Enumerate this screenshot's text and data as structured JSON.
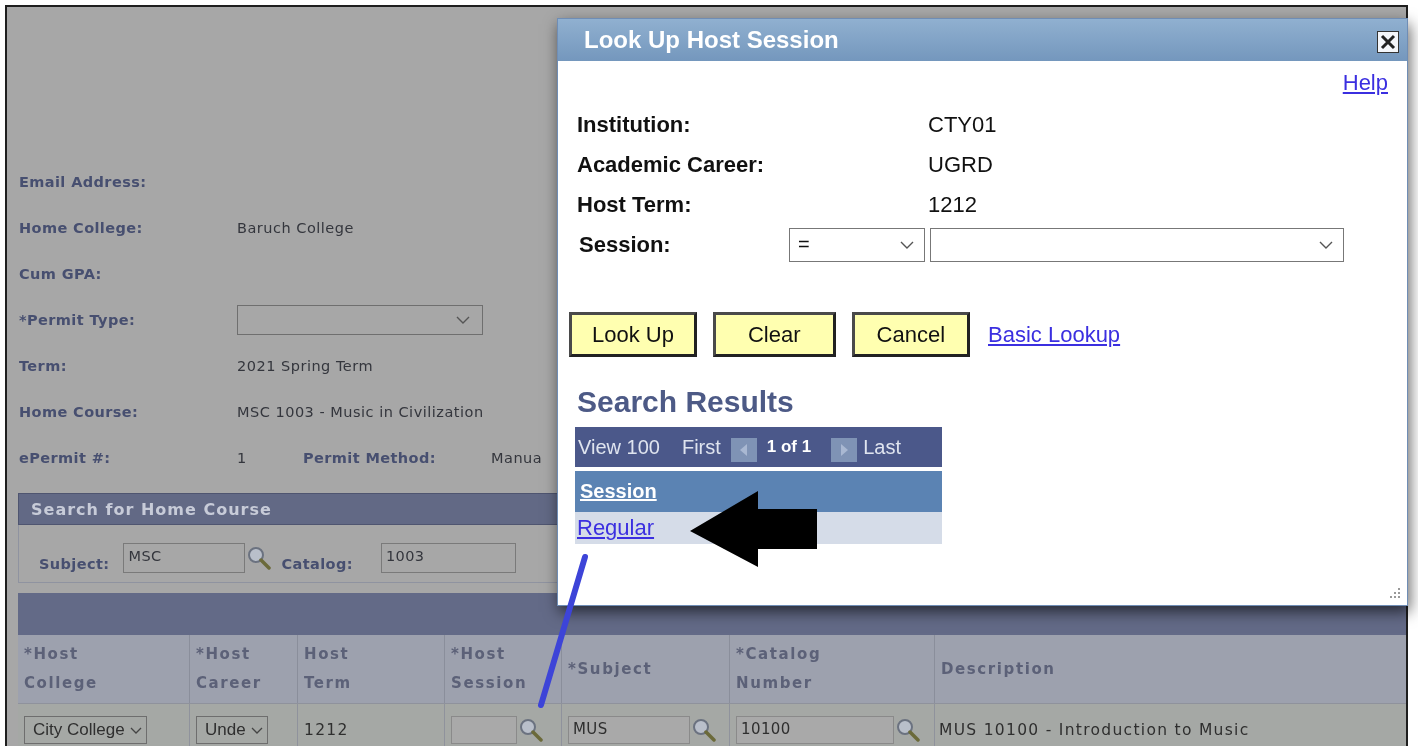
{
  "page": {
    "fields": [
      {
        "kind": "text",
        "label": "Email Address:"
      },
      {
        "kind": "text",
        "label": "Home College:",
        "value": "Baruch College"
      },
      {
        "kind": "text",
        "label": "Cum GPA:"
      },
      {
        "kind": "select",
        "label": "*Permit Type:"
      },
      {
        "kind": "text",
        "label": "Term:",
        "value": "2021 Spring Term"
      },
      {
        "kind": "text",
        "label": "Home Course:",
        "value": "MSC 1003 - Music in Civilization"
      },
      {
        "kind": "pair",
        "label": "ePermit #:",
        "value": "1",
        "label_2": "Permit Method:",
        "value_2": "Manua"
      }
    ],
    "search_section": {
      "title": "Search for Home Course",
      "subject_label": "Subject:",
      "subject_value": "MSC",
      "catalog_label": "Catalog:",
      "catalog_value": "1003"
    },
    "grid": {
      "columns": [
        {
          "lines": [
            "*Host",
            "College"
          ]
        },
        {
          "lines": [
            "*Host",
            "Career"
          ]
        },
        {
          "lines": [
            "Host",
            "Term"
          ]
        },
        {
          "lines": [
            "*Host",
            "Session"
          ]
        },
        {
          "lines": [
            "*Subject"
          ]
        },
        {
          "lines": [
            "*Catalog",
            "Number"
          ]
        },
        {
          "lines": [
            "Description"
          ]
        }
      ],
      "rows": [
        {
          "host_college": "City College",
          "host_career": "Unde",
          "host_term": "1212",
          "subject": "MUS",
          "catalog_number": "10100",
          "description": "MUS 10100 - Introduction to Music"
        }
      ]
    }
  },
  "dialog": {
    "title": "Look Up Host Session",
    "help": "Help",
    "fields": [
      {
        "label": "Institution:",
        "value": "CTY01"
      },
      {
        "label": "Academic Career:",
        "value": "UGRD"
      },
      {
        "label": "Host Term:",
        "value": "1212"
      }
    ],
    "session": {
      "label": "Session:",
      "operator": "="
    },
    "buttons": [
      "Look Up",
      "Clear",
      "Cancel"
    ],
    "link": "Basic Lookup",
    "results": {
      "title": "Search Results",
      "nav": {
        "view": "View 100",
        "first": "First",
        "count": "1 of 1",
        "last": "Last"
      },
      "column": "Session",
      "rows": [
        "Regular"
      ]
    }
  }
}
